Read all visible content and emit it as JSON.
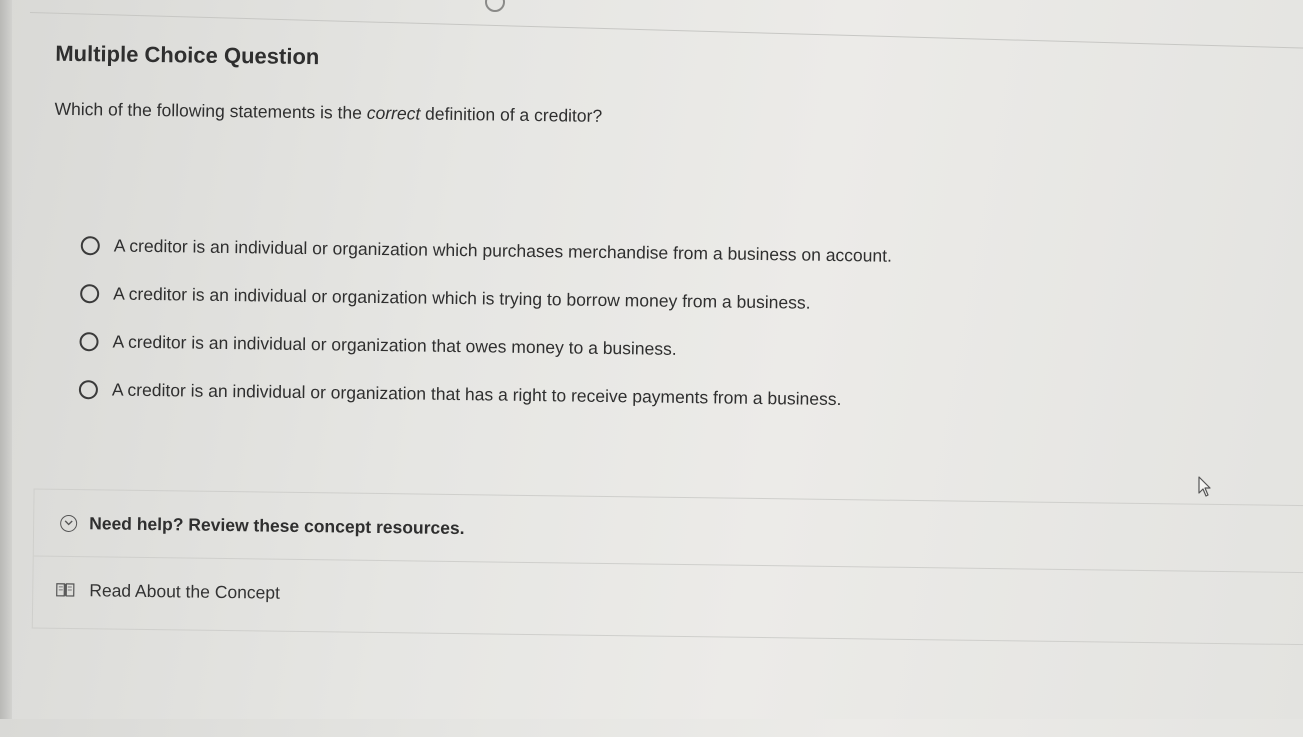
{
  "question": {
    "type_label": "Multiple Choice Question",
    "prompt_before": "Which of the following statements is the ",
    "prompt_emphasis": "correct",
    "prompt_after": " definition of a creditor?"
  },
  "options": [
    {
      "label": "A creditor is an individual or organization which purchases merchandise from a business on account."
    },
    {
      "label": "A creditor is an individual or organization which is trying to borrow money from a business."
    },
    {
      "label": "A creditor is an individual or organization that owes money to a business."
    },
    {
      "label": "A creditor is an individual or organization that has a right to receive payments from a business."
    }
  ],
  "help": {
    "title": "Need help? Review these concept resources.",
    "icon": "chevron-down-circle-icon",
    "resources": [
      {
        "label": "Read About the Concept",
        "icon": "book-icon"
      }
    ]
  },
  "colors": {
    "text": "#2f2f2f",
    "background": "#e6e6e3",
    "divider": "#cfcfcc"
  }
}
